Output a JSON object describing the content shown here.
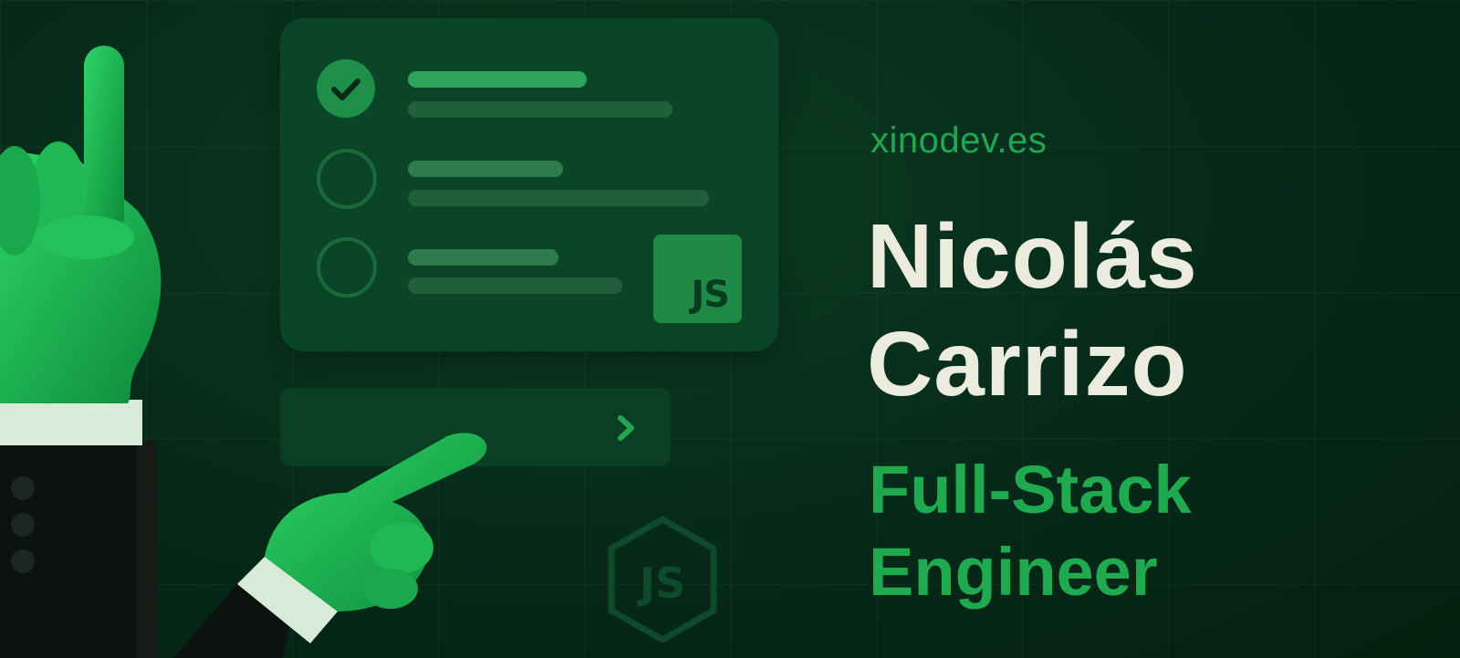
{
  "site": {
    "domain": "xinodev.es"
  },
  "hero": {
    "name_line1": "Nicolás",
    "name_line2": "Carrizo",
    "role_line1": "Full-Stack",
    "role_line2": "Engineer"
  },
  "task_card": {
    "items": [
      {
        "state": "checked",
        "icon": "check-icon"
      },
      {
        "state": "unchecked",
        "icon": "empty-circle"
      },
      {
        "state": "unchecked",
        "icon": "empty-circle"
      }
    ],
    "badge_label": "JS"
  },
  "action_bar": {
    "icon": "chevron-right-icon"
  },
  "watermark": {
    "icon": "nodejs-hex-icon",
    "label": "JS"
  },
  "colors": {
    "background": "#06291a",
    "accent_green": "#22a552",
    "text_light": "#ececde",
    "card": "#0a4528"
  }
}
